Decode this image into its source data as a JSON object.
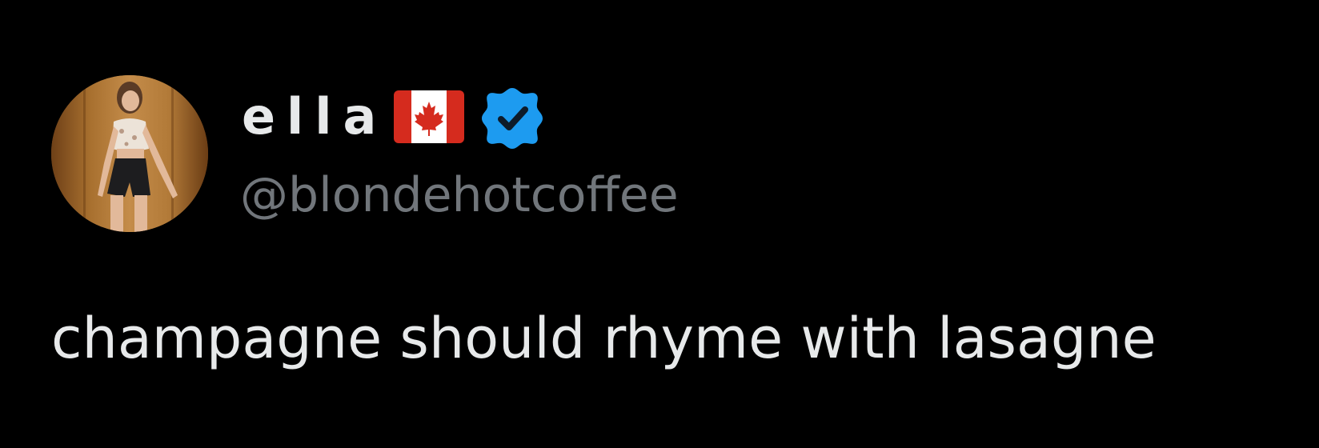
{
  "tweet": {
    "author": {
      "display_name": "ella",
      "flag_icon": "canada-flag-icon",
      "verified_icon": "verified-badge-icon",
      "handle": "@blondehotcoffee"
    },
    "text": "champagne should rhyme with lasagne"
  },
  "colors": {
    "background": "#000000",
    "primary_text": "#e7e9ea",
    "secondary_text": "#71767b",
    "verified_blue": "#1d9bf0",
    "flag_red": "#d52b1e"
  }
}
